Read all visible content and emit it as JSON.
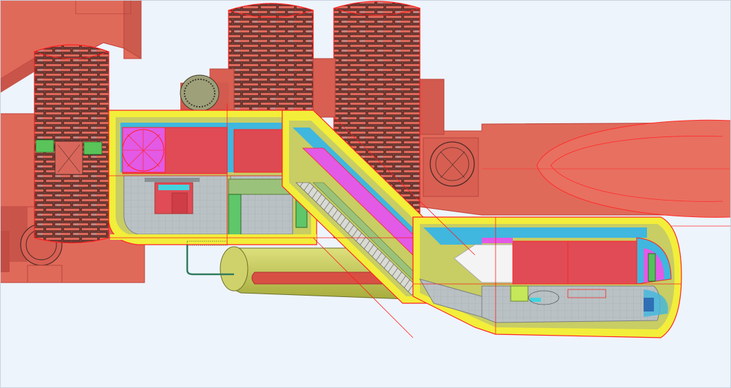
{
  "scene": {
    "type": "3d-bim-model-view",
    "description_visible_text": "",
    "colors": {
      "background": "#eef4fb",
      "concrete_red": "#e06a5a",
      "concrete_dark": "#c9544a",
      "brick_outline": "#4a2a26",
      "wire_red": "#ff1a1a",
      "yellow_lining": "#f2ee3a",
      "olive_shell": "#c9cf6a",
      "olive_dark": "#a9ad44",
      "magenta": "#e45ae8",
      "cyan_blue": "#3fb7df",
      "floor_gray": "#b8c0c4",
      "light_green": "#b3d98a",
      "green_block": "#53c25a",
      "white_panel": "#f4f4f4"
    },
    "elements": [
      "upper-left-slab",
      "left-brick-shaft",
      "center-brick-shaft-1",
      "center-brick-shaft-2",
      "right-horizontal-tunnel",
      "left-horizontal-tunnel",
      "upper-station-box",
      "escalator-incline",
      "lower-station-box",
      "olive-passage-tube",
      "small-cylinder-duct"
    ]
  }
}
